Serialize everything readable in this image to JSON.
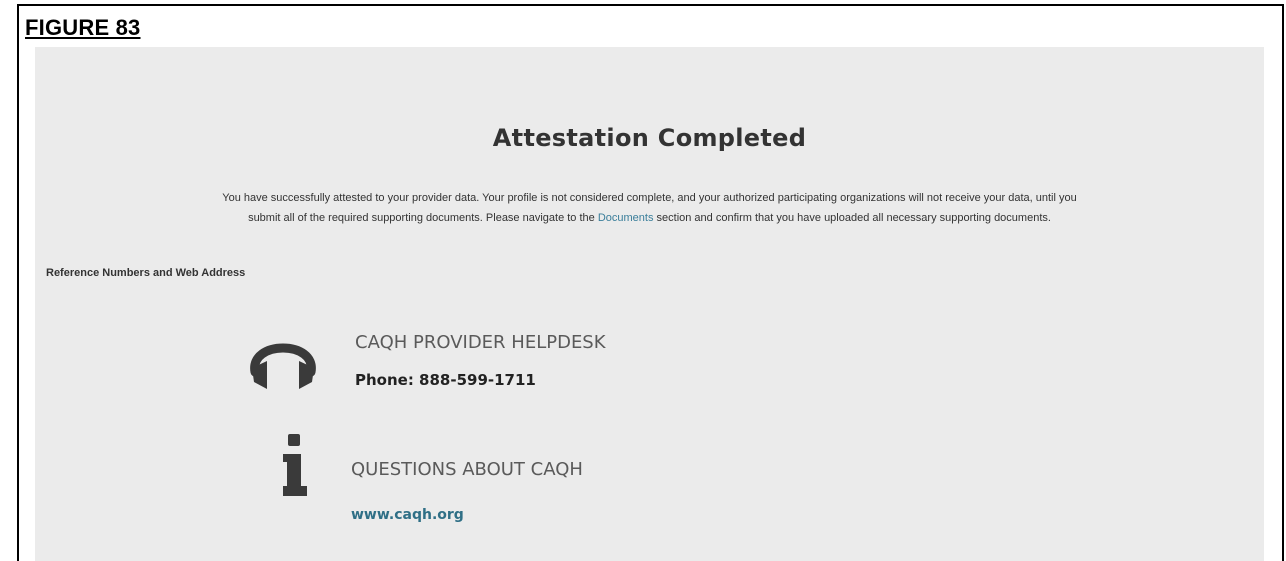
{
  "figure_label": "FIGURE 83",
  "page": {
    "title": "Attestation Completed",
    "message": {
      "line1": "You have successfully attested to your provider data. Your profile is not considered complete, and your authorized participating organizations will not receive your data, until you",
      "line2_before": "submit all of the required supporting documents. Please navigate to the ",
      "link_text": "Documents",
      "line2_after": " section and confirm that you have uploaded all necessary supporting documents."
    },
    "reference_heading": "Reference Numbers and Web Address",
    "helpdesk": {
      "icon": "headset-icon",
      "title": "CAQH PROVIDER HELPDESK",
      "phone": "Phone: 888-599-1711"
    },
    "questions": {
      "icon": "info-icon",
      "title": "QUESTIONS ABOUT CAQH",
      "website": "www.caqh.org"
    }
  },
  "colors": {
    "panel_background": "#ebebeb",
    "link": "#3a7e9a",
    "icon": "#3a3a3a",
    "heading_text": "#333333"
  }
}
